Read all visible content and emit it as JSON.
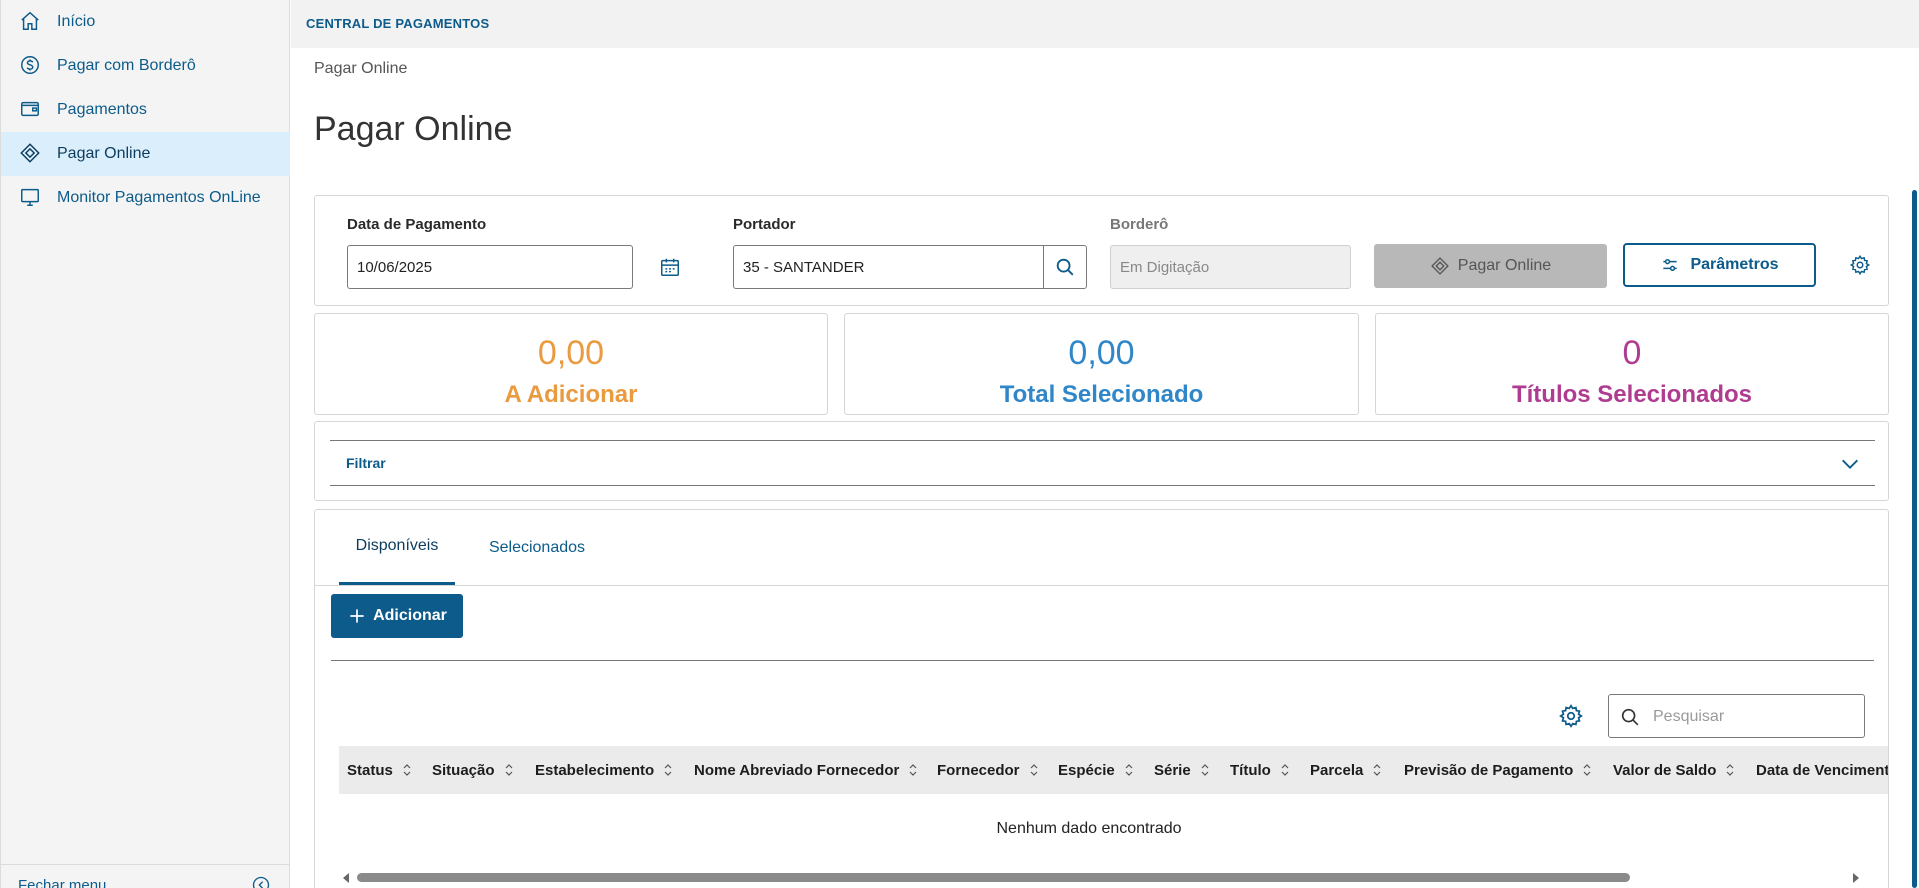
{
  "sidebar": {
    "items": [
      {
        "label": "Início",
        "icon": "home-icon"
      },
      {
        "label": "Pagar com Borderô",
        "icon": "dollar-circle-icon"
      },
      {
        "label": "Pagamentos",
        "icon": "wallet-icon"
      },
      {
        "label": "Pagar Online",
        "icon": "diamond-arrows-icon"
      },
      {
        "label": "Monitor Pagamentos OnLine",
        "icon": "monitor-icon"
      }
    ],
    "active_index": 3,
    "footer_label": "Fechar menu"
  },
  "header": {
    "app_title": "CENTRAL DE PAGAMENTOS"
  },
  "breadcrumb": "Pagar Online",
  "page_title": "Pagar Online",
  "form": {
    "payment_date_label": "Data de Pagamento",
    "payment_date_value": "10/06/2025",
    "carrier_label": "Portador",
    "carrier_value": "35 - SANTANDER",
    "bordero_label": "Borderô",
    "bordero_value": "Em Digitação",
    "pay_online_button": "Pagar Online",
    "parameters_button": "Parâmetros"
  },
  "stats": [
    {
      "value": "0,00",
      "label": "A Adicionar",
      "color": "#ea9a3f"
    },
    {
      "value": "0,00",
      "label": "Total Selecionado",
      "color": "#2f86c8"
    },
    {
      "value": "0",
      "label": "Títulos Selecionados",
      "color": "#b03c92"
    }
  ],
  "filter": {
    "label": "Filtrar"
  },
  "tabs": [
    {
      "label": "Disponíveis",
      "active": true
    },
    {
      "label": "Selecionados",
      "active": false
    }
  ],
  "add_button": "Adicionar",
  "table": {
    "search_placeholder": "Pesquisar",
    "columns": [
      "Status",
      "Situação",
      "Estabelecimento",
      "Nome Abreviado Fornecedor",
      "Fornecedor",
      "Espécie",
      "Série",
      "Título",
      "Parcela",
      "Previsão de Pagamento",
      "Valor de Saldo",
      "Data de Vencimento"
    ],
    "empty_message": "Nenhum dado encontrado"
  },
  "colors": {
    "primary": "#0c5b8a",
    "active_menu_bg": "#dbeefb"
  }
}
